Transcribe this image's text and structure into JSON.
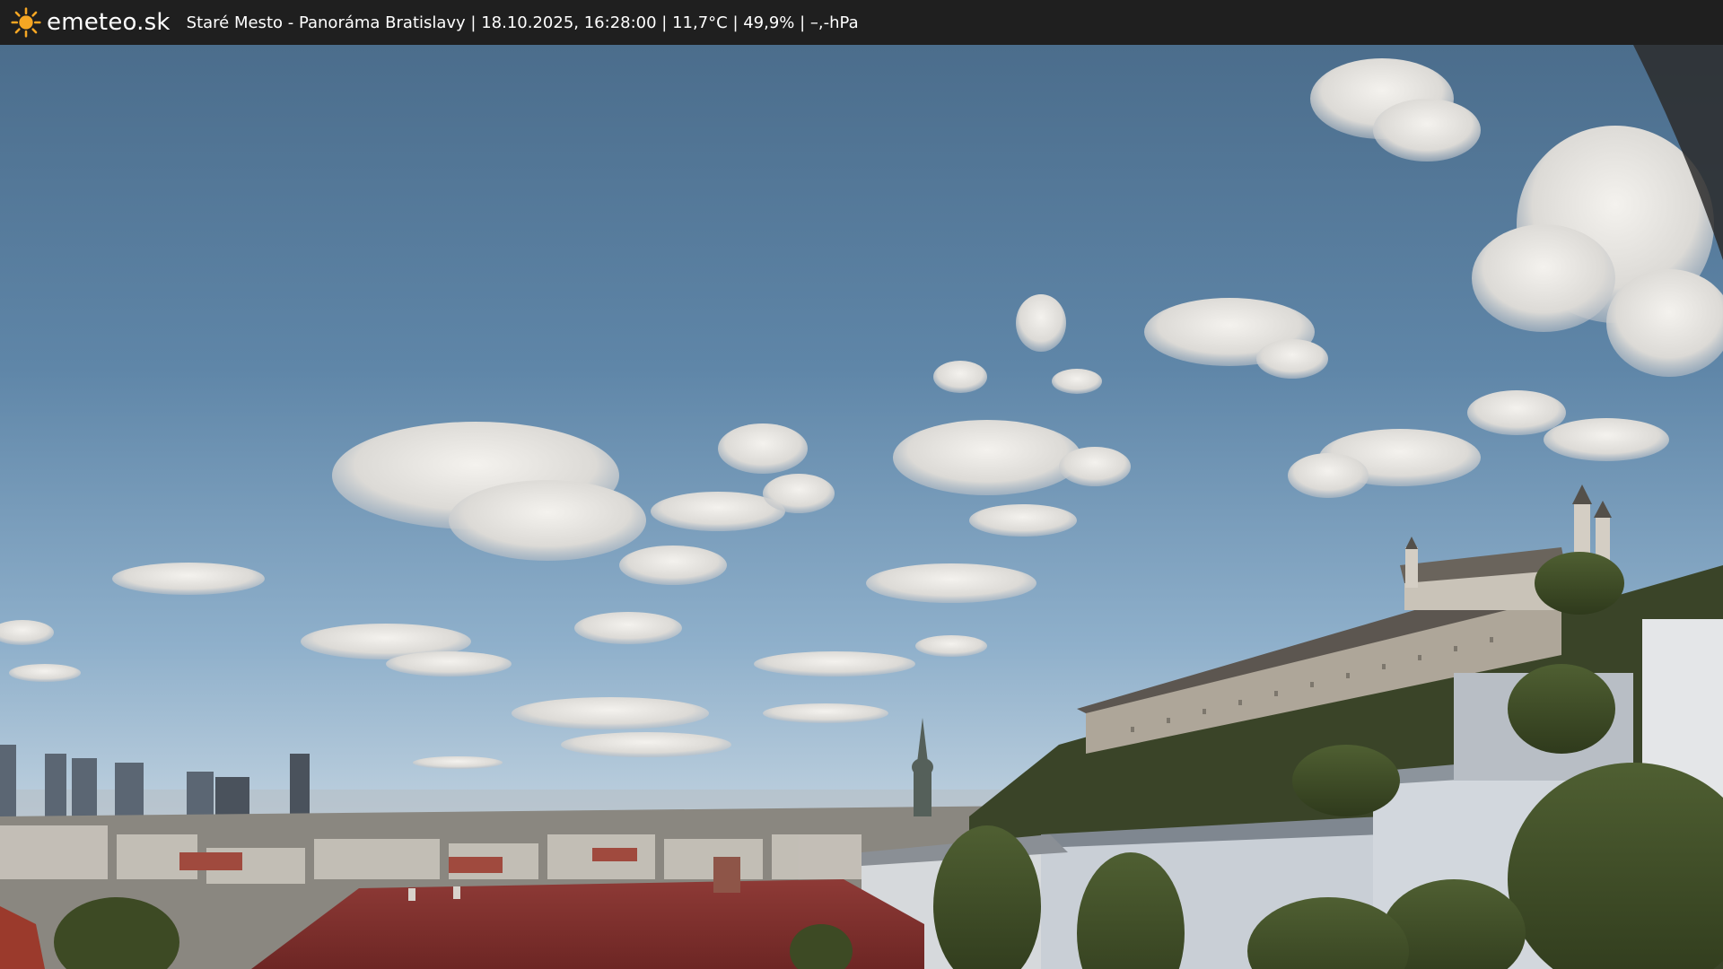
{
  "app": {
    "brand": "emeteo.sk",
    "logo_icon": "sun-icon"
  },
  "caption": {
    "text": "Staré Mesto - Panoráma Bratislavy | 18.10.2025, 16:28:00 | 11,7°C | 49,9% | –,-hPa"
  },
  "colors": {
    "topbar_bg": "#1f1f1f",
    "sun": "#f5a623",
    "sky_top": "#4d7191",
    "sky_horizon": "#c9d8e3"
  }
}
